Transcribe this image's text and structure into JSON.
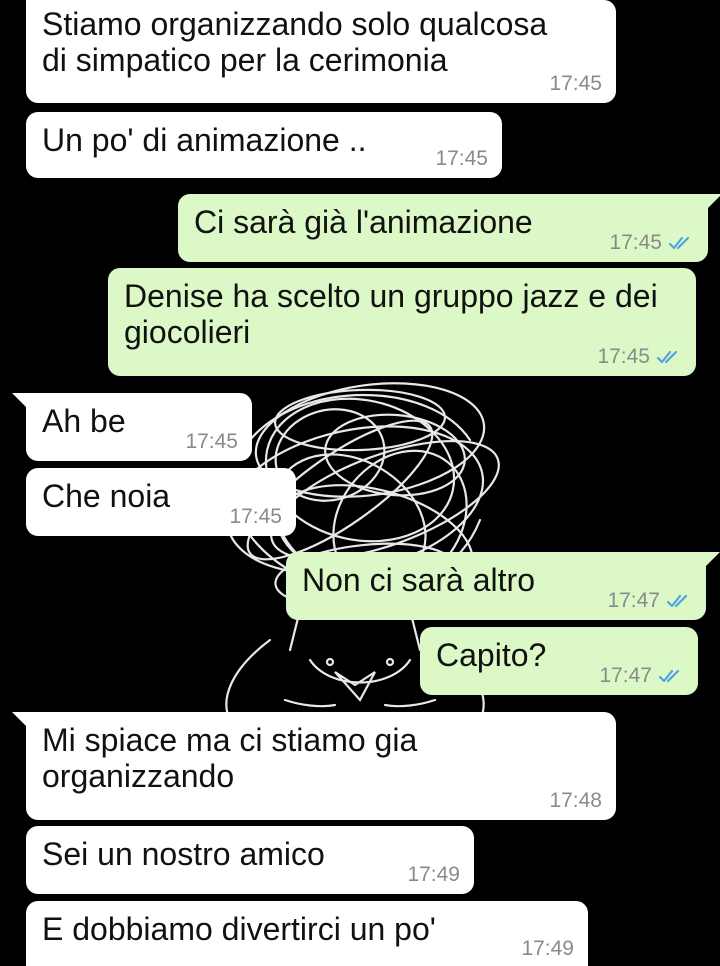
{
  "colors": {
    "incoming": "#ffffff",
    "outgoing": "#dcf8c6",
    "tick_read": "#4fa3e3",
    "time": "#8a8a8a",
    "background": "#000000"
  },
  "messages": [
    {
      "dir": "in",
      "text": "Stiamo organizzando solo qualcosa\ndi simpatico per la cerimonia",
      "time": "17:45"
    },
    {
      "dir": "in",
      "text": "Un po' di animazione ..",
      "time": "17:45"
    },
    {
      "dir": "out",
      "text": "Ci sarà già l'animazione",
      "time": "17:45",
      "status": "read-double-check-icon"
    },
    {
      "dir": "out",
      "text": "Denise ha scelto un gruppo jazz e dei\ngiocolieri",
      "time": "17:45",
      "status": "read-double-check-icon"
    },
    {
      "dir": "in",
      "text": "Ah be",
      "time": "17:45"
    },
    {
      "dir": "in",
      "text": "Che noia",
      "time": "17:45"
    },
    {
      "dir": "out",
      "text": "Non ci sarà altro",
      "time": "17:47",
      "status": "read-double-check-icon"
    },
    {
      "dir": "out",
      "text": "Capito?",
      "time": "17:47",
      "status": "read-double-check-icon"
    },
    {
      "dir": "in",
      "text": "Mi spiace ma ci stiamo gia\norganizzando",
      "time": "17:48"
    },
    {
      "dir": "in",
      "text": "Sei un nostro amico",
      "time": "17:49"
    },
    {
      "dir": "in",
      "text": "E dobbiamo divertirci un po'",
      "time": "17:49"
    }
  ]
}
